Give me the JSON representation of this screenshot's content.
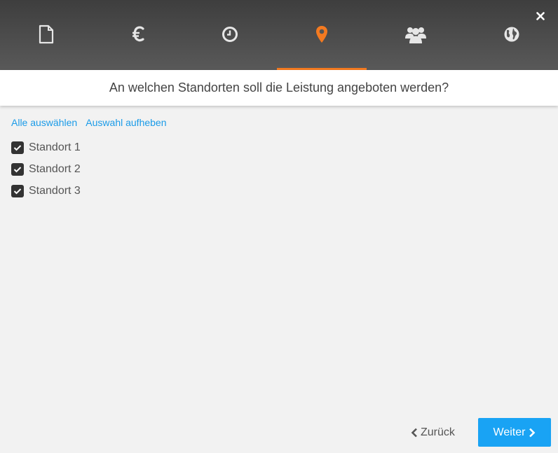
{
  "dialog": {
    "close_symbol": "✕"
  },
  "tabs": [
    {
      "icon": "document-icon",
      "active": false
    },
    {
      "icon": "euro-icon",
      "active": false
    },
    {
      "icon": "clock-icon",
      "active": false
    },
    {
      "icon": "map-marker-icon",
      "active": true
    },
    {
      "icon": "users-icon",
      "active": false
    },
    {
      "icon": "globe-icon",
      "active": false
    }
  ],
  "colors": {
    "accent": "#f47a20",
    "primary": "#19a3f4",
    "link": "#1a9be8"
  },
  "question": "An welchen Standorten soll die Leistung angeboten werden?",
  "selection": {
    "select_all": "Alle auswählen",
    "deselect": "Auswahl aufheben"
  },
  "locations": [
    {
      "label": "Standort 1",
      "checked": true
    },
    {
      "label": "Standort 2",
      "checked": true
    },
    {
      "label": "Standort 3",
      "checked": true
    }
  ],
  "footer": {
    "back_label": "Zurück",
    "next_label": "Weiter"
  }
}
